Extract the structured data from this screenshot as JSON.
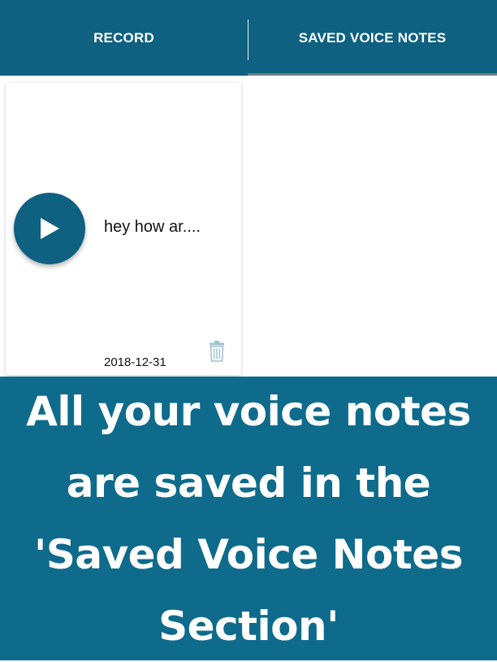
{
  "tabs": {
    "record_label": "RECORD",
    "saved_label": "SAVED VOICE NOTES",
    "active": "saved"
  },
  "note": {
    "title": "hey how ar....",
    "date": "2018-12-31"
  },
  "icons": {
    "play": "play-icon",
    "delete": "trash-icon"
  },
  "colors": {
    "primary": "#0e6180",
    "banner": "#0e6b8b",
    "trash": "#9fc3d3"
  },
  "banner": {
    "line1": "All your voice notes",
    "line2": "are saved in the",
    "line3": "'Saved Voice Notes",
    "line4": "Section'"
  }
}
